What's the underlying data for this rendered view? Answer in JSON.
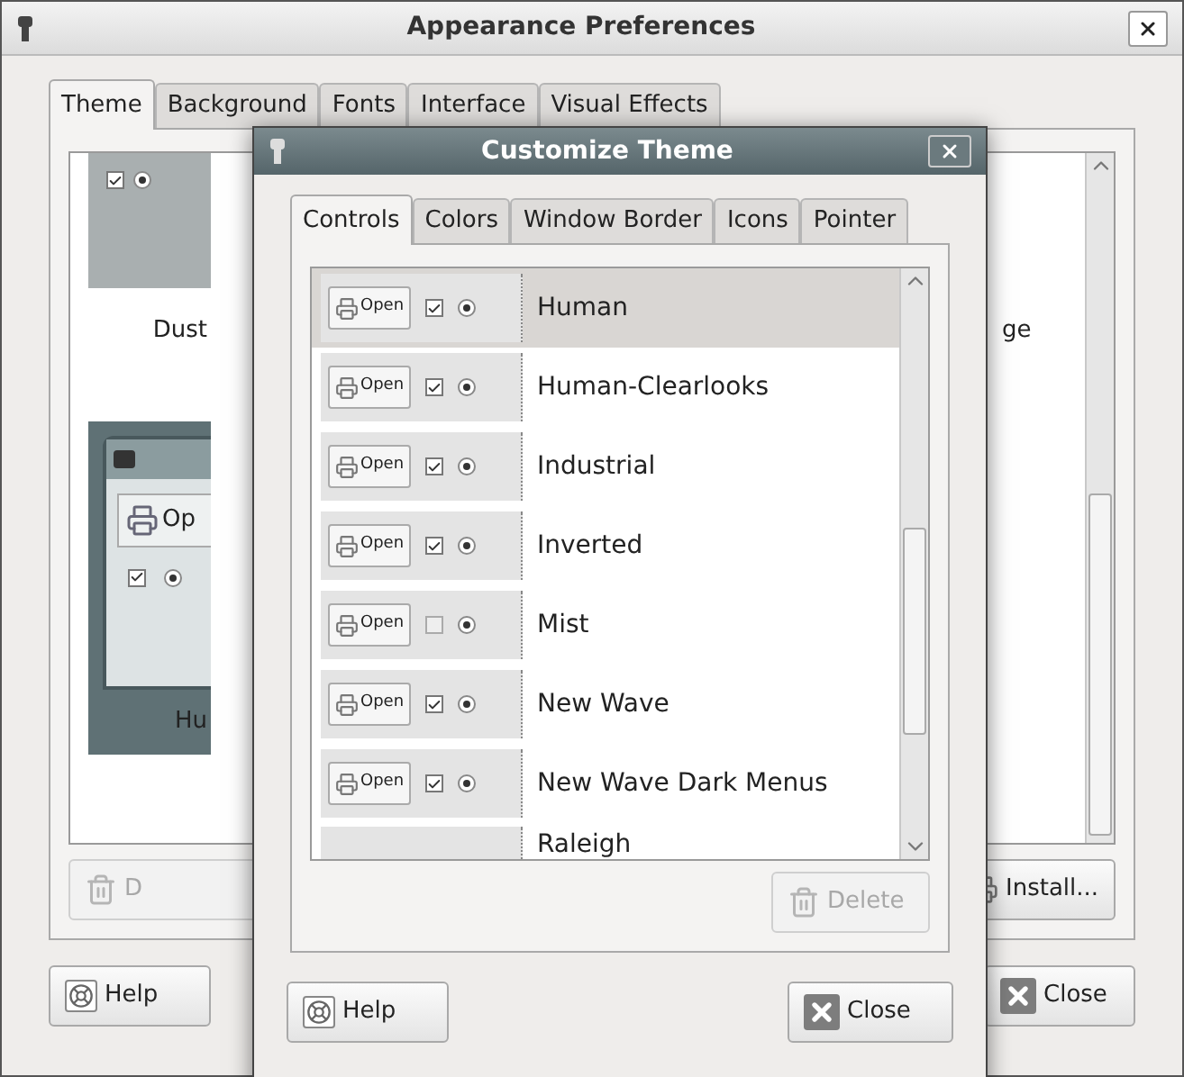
{
  "window": {
    "title": "Appearance Preferences"
  },
  "tabs": [
    {
      "label": "Theme",
      "selected": true
    },
    {
      "label": "Background",
      "selected": false
    },
    {
      "label": "Fonts",
      "selected": false
    },
    {
      "label": "Interface",
      "selected": false
    },
    {
      "label": "Visual Effects",
      "selected": false
    }
  ],
  "theme_grid": {
    "left_labels": [
      "Dust",
      "Hu"
    ],
    "right_labels": [
      "ge"
    ],
    "preview_button": "Op"
  },
  "buttons": {
    "delete": {
      "label": "D",
      "disabled": true
    },
    "install": "Install...",
    "help": "Help",
    "close": "Close"
  },
  "dialog": {
    "title": "Customize Theme",
    "tabs": [
      {
        "label": "Controls",
        "selected": true
      },
      {
        "label": "Colors",
        "selected": false
      },
      {
        "label": "Window Border",
        "selected": false
      },
      {
        "label": "Icons",
        "selected": false
      },
      {
        "label": "Pointer",
        "selected": false
      }
    ],
    "themes": [
      {
        "name": "Human",
        "selected": true,
        "checked": true,
        "preview_button": "Open"
      },
      {
        "name": "Human-Clearlooks",
        "selected": false,
        "checked": true,
        "preview_button": "Open"
      },
      {
        "name": "Industrial",
        "selected": false,
        "checked": true,
        "preview_button": "Open"
      },
      {
        "name": "Inverted",
        "selected": false,
        "checked": true,
        "preview_button": "Open"
      },
      {
        "name": "Mist",
        "selected": false,
        "checked": false,
        "preview_button": "Open"
      },
      {
        "name": "New Wave",
        "selected": false,
        "checked": true,
        "preview_button": "Open"
      },
      {
        "name": "New Wave Dark Menus",
        "selected": false,
        "checked": true,
        "preview_button": "Open"
      },
      {
        "name": "Raleigh",
        "selected": false
      }
    ],
    "delete": {
      "label": "Delete",
      "disabled": true
    },
    "help": "Help",
    "close": "Close"
  }
}
